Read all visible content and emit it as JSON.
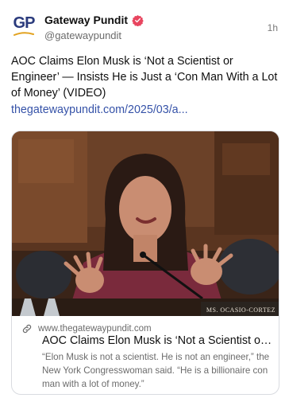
{
  "author": {
    "avatar_text": "GP",
    "name": "Gateway Pundit",
    "handle": "@gatewaypundit",
    "verified": true
  },
  "timestamp": "1h",
  "post": {
    "text": "AOC Claims Elon Musk is ‘Not a Scientist or Engineer’ — Insists He is Just a ‘Con Man With a Lot of Money’ (VIDEO)",
    "link": "thegatewaypundit.com/2025/03/a..."
  },
  "card": {
    "image_caption_text": "MS. OCASIO-CORTEZ",
    "domain": "www.thegatewaypundit.com",
    "title": "AOC Claims Elon Musk is ‘Not a Scientist or En...",
    "description": "“Elon Musk is not a scientist. He is not an engineer,” the New York Congresswoman said. “He is a billionaire con man with a lot of money.”"
  },
  "colors": {
    "brand_blue": "#2a3a7c",
    "brand_gold": "#e2a21f",
    "verified_badge": "#e8455f",
    "link": "#3552a8"
  },
  "icons": {
    "verified": "verified-badge-icon",
    "link": "link-icon"
  }
}
